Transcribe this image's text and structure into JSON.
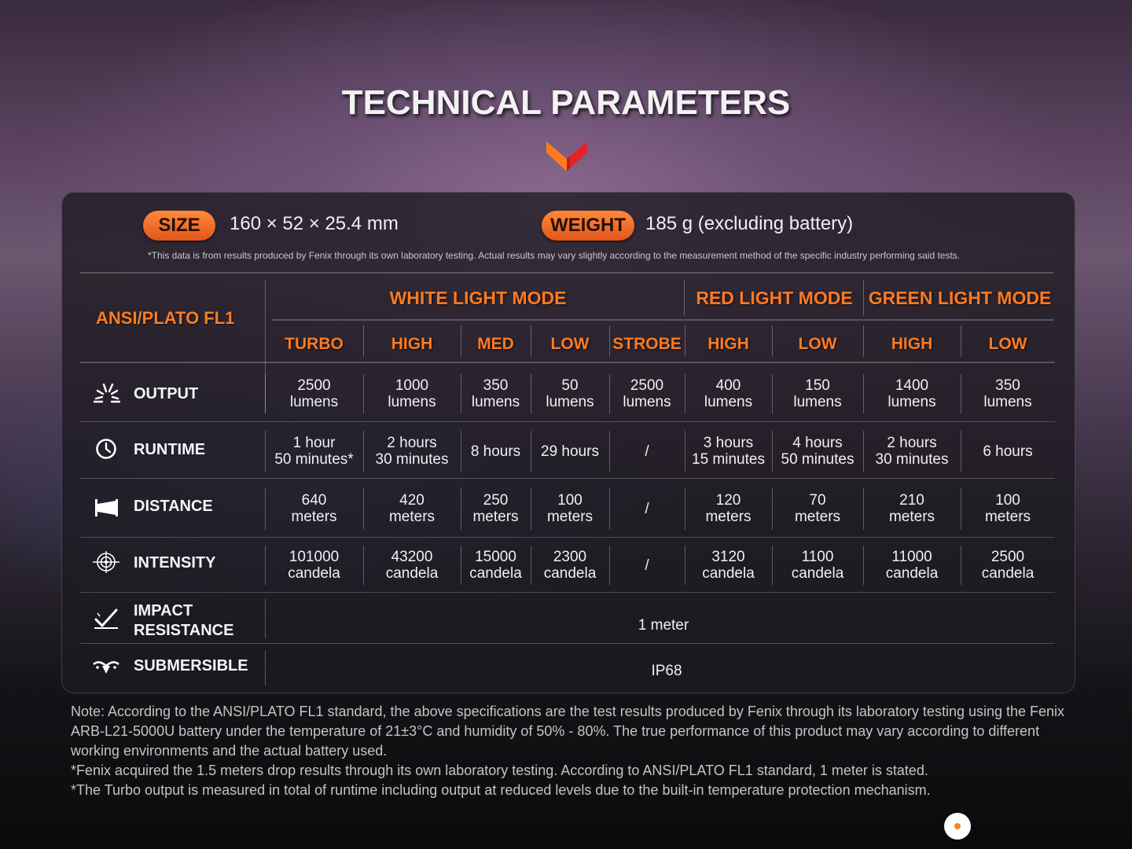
{
  "title": "TECHNICAL PARAMETERS",
  "size": {
    "label": "SIZE",
    "value": "160 × 52 ×  25.4 mm"
  },
  "weight": {
    "label": "WEIGHT",
    "value": "185 g (excluding battery)"
  },
  "disclaimer": "*This data is from results produced by Fenix through its own laboratory testing. Actual results may vary slightly according to the measurement method of the specific industry performing said tests.",
  "table": {
    "standard": "ANSI/PLATO FL1",
    "modes": [
      "WHITE LIGHT MODE",
      "RED LIGHT MODE",
      "GREEN LIGHT MODE"
    ],
    "submodes": [
      "TURBO",
      "HIGH",
      "MED",
      "LOW",
      "STROBE",
      "HIGH",
      "LOW",
      "HIGH",
      "LOW"
    ],
    "rows": [
      {
        "label": "OUTPUT",
        "icon": "burst-icon",
        "cells": [
          "2500\nlumens",
          "1000\nlumens",
          "350\nlumens",
          "50\nlumens",
          "2500\nlumens",
          "400\nlumens",
          "150\nlumens",
          "1400\nlumens",
          "350\nlumens"
        ]
      },
      {
        "label": "RUNTIME",
        "icon": "clock-icon",
        "cells": [
          "1 hour\n50 minutes*",
          "2 hours\n30 minutes",
          "8 hours",
          "29 hours",
          "/",
          "3 hours\n15 minutes",
          "4 hours\n50 minutes",
          "2 hours\n30 minutes",
          "6 hours"
        ]
      },
      {
        "label": "DISTANCE",
        "icon": "beam-distance-icon",
        "cells": [
          "640\nmeters",
          "420\nmeters",
          "250\nmeters",
          "100\nmeters",
          "/",
          "120\nmeters",
          "70\nmeters",
          "210\nmeters",
          "100\nmeters"
        ]
      },
      {
        "label": "INTENSITY",
        "icon": "crosshair-icon",
        "cells": [
          "101000\ncandela",
          "43200\ncandela",
          "15000\ncandela",
          "2300\ncandela",
          "/",
          "3120\ncandela",
          "1100\ncandela",
          "11000\ncandela",
          "2500\ncandela"
        ]
      }
    ],
    "impact": {
      "label": "IMPACT\nRESISTANCE",
      "icon": "impact-icon",
      "value": "1 meter"
    },
    "submersible": {
      "label": "SUBMERSIBLE",
      "icon": "submersible-icon",
      "value": "IP68"
    }
  },
  "notes": [
    "Note: According to the ANSI/PLATO FL1 standard, the above specifications are the test results produced by Fenix through its laboratory testing using the Fenix ARB-L21-5000U battery under the temperature of 21±3°C and humidity of 50% - 80%. The true performance of this product may vary according to different working environments and the actual battery used.",
    "*Fenix acquired the 1.5 meters drop results through its own laboratory testing. According to ANSI/PLATO FL1 standard, 1 meter is stated.",
    "*The Turbo output is measured in total of runtime including output at reduced levels due to the built-in temperature protection mechanism."
  ],
  "colors": {
    "accent": "#ff7a22",
    "pill": "#f06a26"
  }
}
